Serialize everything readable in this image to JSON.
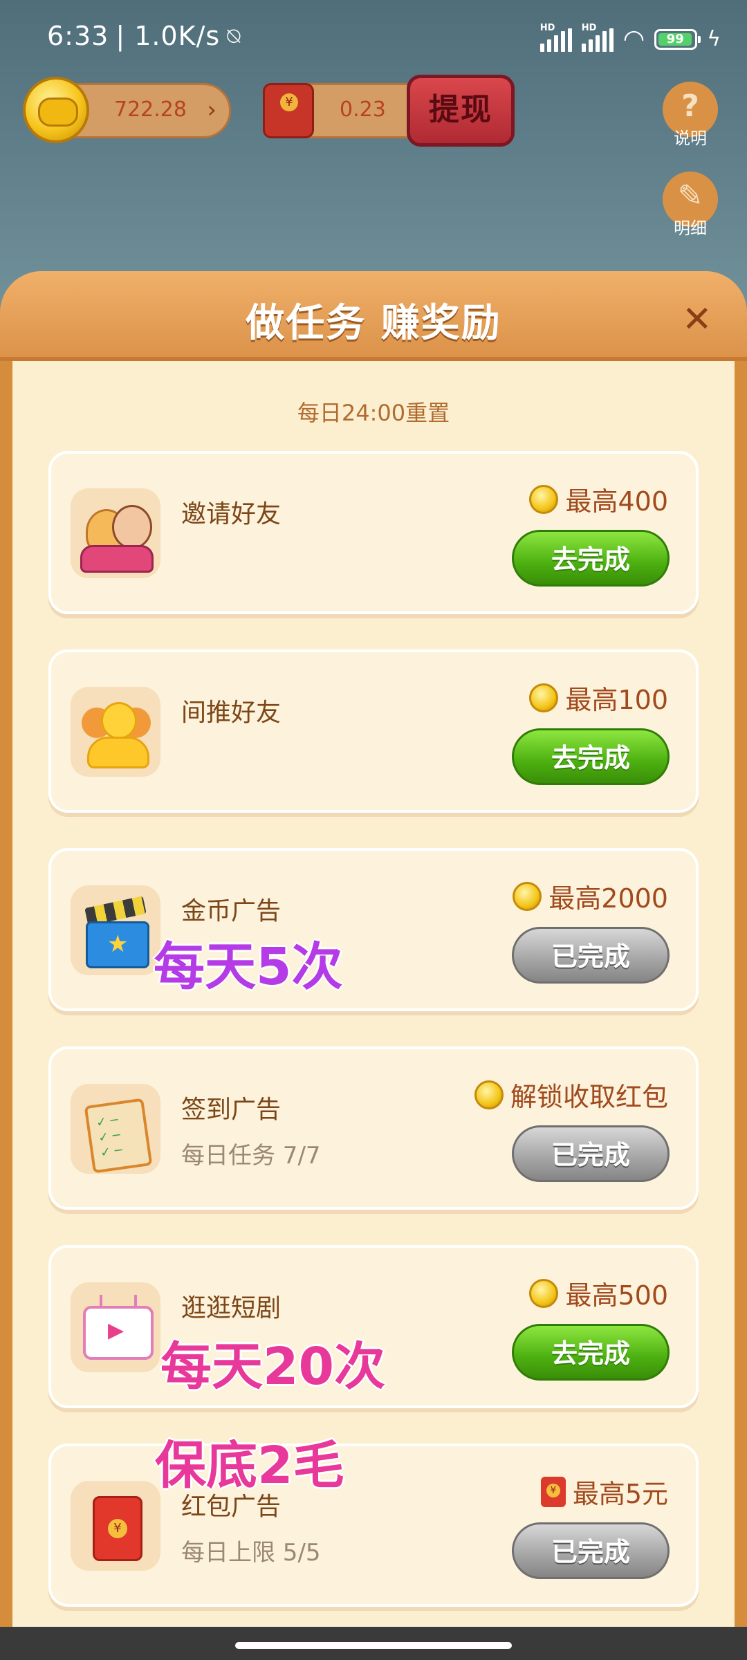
{
  "status_bar": {
    "time": "6:33",
    "speed": "| 1.0K/s",
    "battery": "99"
  },
  "top": {
    "coins": "722.28",
    "red_packet": "0.23",
    "withdraw_label": "提现",
    "side": [
      {
        "label": "说明"
      },
      {
        "label": "明细"
      }
    ]
  },
  "panel": {
    "title": "做任务 赚奖励",
    "reset_note": "每日24:00重置",
    "tasks": [
      {
        "name": "邀请好友",
        "sub": "",
        "reward": "最高400",
        "button": "去完成",
        "status": "active"
      },
      {
        "name": "间推好友",
        "sub": "",
        "reward": "最高100",
        "button": "去完成",
        "status": "active"
      },
      {
        "name": "金币广告",
        "sub": "",
        "reward": "最高2000",
        "button": "已完成",
        "status": "done"
      },
      {
        "name": "签到广告",
        "sub": "每日任务 7/7",
        "reward": "解锁收取红包",
        "button": "已完成",
        "status": "done"
      },
      {
        "name": "逛逛短剧",
        "sub": "",
        "reward": "最高500",
        "button": "去完成",
        "status": "active"
      },
      {
        "name": "红包广告",
        "sub": "每日上限 5/5",
        "reward": "最高5元",
        "button": "已完成",
        "status": "done"
      }
    ]
  },
  "overlays": {
    "gold_ad": "每天5次",
    "drama": "每天20次",
    "red_ad": "保底2毛"
  },
  "colors": {
    "overlay_purple": "#b43be6",
    "overlay_pink": "#e8389a",
    "button_green": "#4cb010",
    "button_gray": "#a4a4a4",
    "panel_orange": "#d58c3b"
  }
}
